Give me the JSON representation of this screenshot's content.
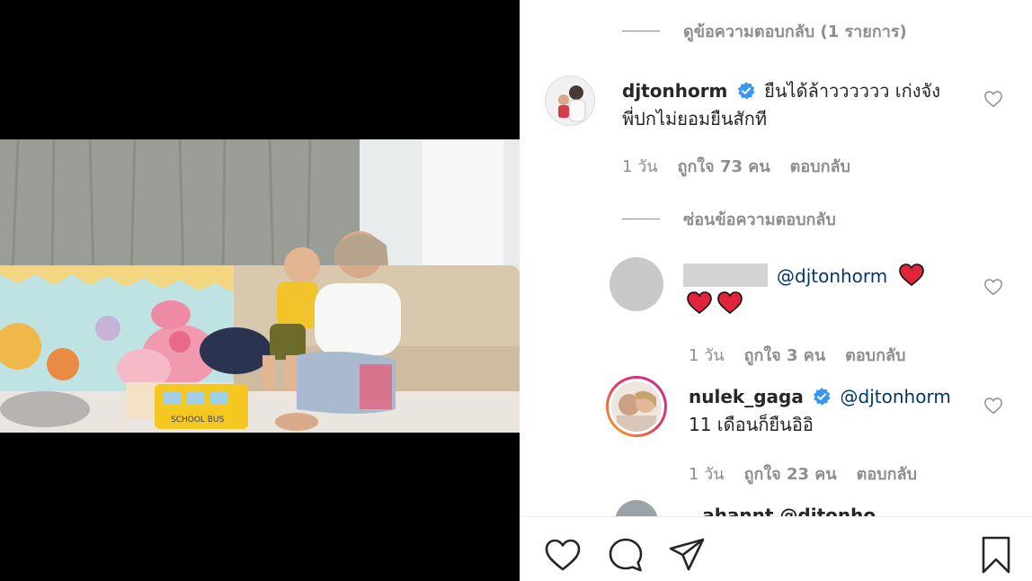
{
  "post": {
    "view_replies_label": "ดูข้อความตอบกลับ (1 รายการ)",
    "hide_replies_label": "ซ่อนข้อความตอบกลับ"
  },
  "comments": [
    {
      "username": "djtonhorm",
      "verified": true,
      "text_line1": "ยืนได้ล้าวววววว เก่งจัง",
      "text_line2": "พี่ปกไม่ยอมยืนสักที",
      "time": "1 วัน",
      "likes": "ถูกใจ 73 คน",
      "reply_label": "ตอบกลับ"
    }
  ],
  "replies": [
    {
      "username": "",
      "mention": "@djtonhorm",
      "time": "1 วัน",
      "likes": "ถูกใจ 3 คน",
      "reply_label": "ตอบกลับ"
    },
    {
      "username": "nulek_gaga",
      "verified": true,
      "mention": "@djtonhorm",
      "text": "11 เดือนก็ยืนอิอิ",
      "time": "1 วัน",
      "likes": "ถูกใจ 23 คน",
      "reply_label": "ตอบกลับ"
    },
    {
      "partial_text": "..ahannt @djtonho"
    }
  ],
  "video": {
    "toy_label": "SCHOOL BUS"
  },
  "colors": {
    "verified_blue": "#3897f0",
    "heart_red": "#e0243b",
    "meta_gray": "#8e8e8e"
  },
  "icons": [
    "heart-icon",
    "comment-icon",
    "share-icon",
    "bookmark-icon",
    "verified-badge-icon"
  ]
}
